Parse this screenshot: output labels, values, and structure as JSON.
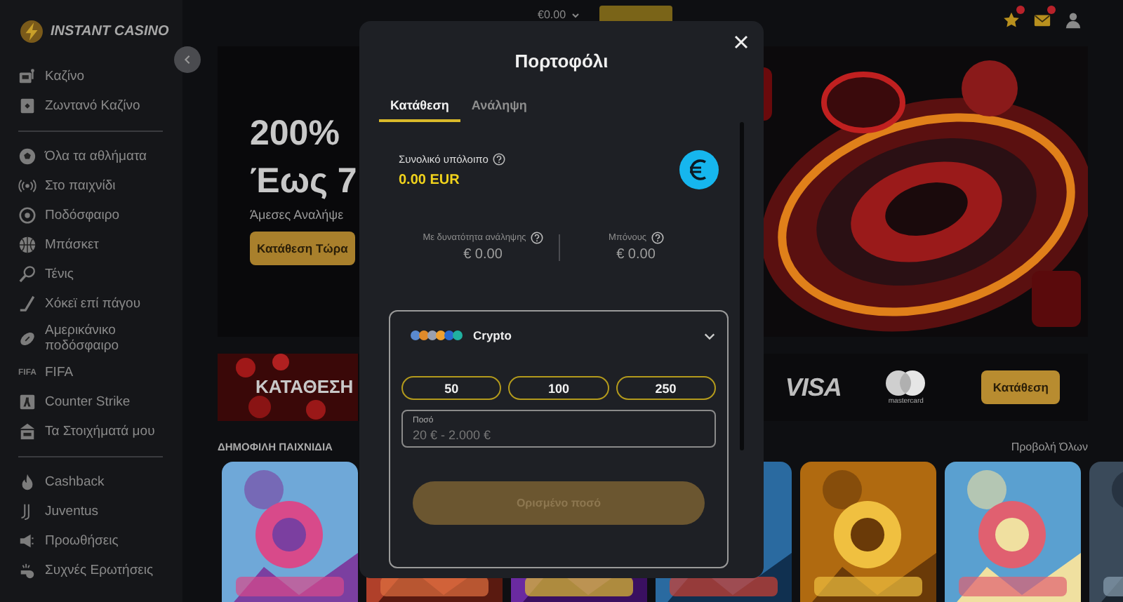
{
  "header": {
    "logo": "INSTANT CASINO",
    "balance": "€0.00",
    "notifications": [
      {
        "kind": "star",
        "badge": true
      },
      {
        "kind": "mail",
        "badge": true
      },
      {
        "kind": "user",
        "badge": false
      }
    ]
  },
  "sidebar": {
    "sections": [
      [
        {
          "label": "Καζίνο",
          "kind": "casino"
        },
        {
          "label": "Ζωντανό Καζίνο",
          "kind": "live"
        }
      ],
      [
        {
          "label": "Όλα τα αθλήματα",
          "kind": "sports"
        },
        {
          "label": "Στο παιχνίδι",
          "kind": "inplay"
        },
        {
          "label": "Ποδόσφαιρο",
          "kind": "football"
        },
        {
          "label": "Μπάσκετ",
          "kind": "basketball"
        },
        {
          "label": "Τένις",
          "kind": "tennis"
        },
        {
          "label": "Χόκεϊ επί πάγου",
          "kind": "hockey"
        },
        {
          "label": "Αμερικάνικο ποδόσφαιρο",
          "kind": "american"
        },
        {
          "label": "FIFA",
          "kind": "text",
          "icon_text": "FIFA"
        },
        {
          "label": "Counter Strike",
          "kind": "cs"
        },
        {
          "label": "Τα Στοιχήματά μου",
          "kind": "bets"
        }
      ],
      [
        {
          "label": "Cashback",
          "kind": "cashback"
        },
        {
          "label": "Juventus",
          "kind": "crest"
        },
        {
          "label": "Προωθήσεις",
          "kind": "promo"
        },
        {
          "label": "Συχνές Ερωτήσεις",
          "kind": "faq"
        }
      ]
    ]
  },
  "hero": {
    "headline": [
      "200%",
      "Έως 7"
    ],
    "subtitle": "Άμεσες Αναλήψε",
    "button": "Κατάθεση Τώρα"
  },
  "deposit_strip": {
    "title": "ΚΑΤΑΘΕΣΗ",
    "card_brands": [
      "VISA",
      "mastercard"
    ],
    "button": "Κατάθεση"
  },
  "popular": {
    "title": "ΔΗΜΟΦΙΛΗ ΠΑΙΧΝΙΔΙΑ",
    "view_all": "Προβολή Όλων"
  },
  "wallet": {
    "title": "Πορτοφόλι",
    "tabs": [
      {
        "label": "Κατάθεση",
        "selected": true
      },
      {
        "label": "Ανάληψη",
        "selected": false
      }
    ],
    "total_balance": {
      "label": "Συνολικό υπόλοιπο",
      "value": "0.00 EUR"
    },
    "balances": [
      {
        "label": "Με δυνατότητα ανάληψης",
        "value": "€ 0.00"
      },
      {
        "label": "Μπόνους",
        "value": "€ 0.00"
      }
    ],
    "payment_method": {
      "name": "Crypto",
      "expanded": true
    },
    "amount_presets": [
      "50",
      "100",
      "250"
    ],
    "amount_field": {
      "label": "Ποσό",
      "placeholder": "20 € - 2.000 €"
    },
    "submit": {
      "label": "Ορισμένο ποσό",
      "disabled": true
    }
  }
}
